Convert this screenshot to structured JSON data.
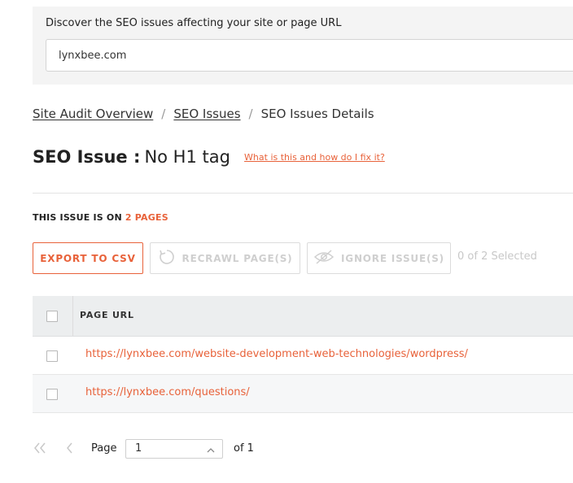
{
  "search": {
    "label": "Discover the SEO issues affecting your site or page URL",
    "value": "lynxbee.com"
  },
  "breadcrumb": {
    "items": [
      "Site Audit Overview",
      "SEO Issues"
    ],
    "current": "SEO Issues Details",
    "separator": "/"
  },
  "title": {
    "prefix": "SEO Issue :",
    "issue": "No H1 tag",
    "help_link": "What is this and how do I fix it?"
  },
  "issue_count": {
    "prefix": "THIS ISSUE IS ON",
    "count": "2 PAGES"
  },
  "toolbar": {
    "export_label": "EXPORT TO CSV",
    "recrawl_label": "RECRAWL PAGE(S)",
    "ignore_label": "IGNORE ISSUE(S)",
    "selected_text": "0 of 2 Selected"
  },
  "table": {
    "header": "PAGE URL",
    "rows": [
      "https://lynxbee.com/website-development-web-technologies/wordpress/",
      "https://lynxbee.com/questions/"
    ]
  },
  "pagination": {
    "page_label": "Page",
    "current_page": "1",
    "of_label": "of 1"
  },
  "colors": {
    "accent": "#e8623a",
    "disabled": "#cfcfcf",
    "header_bg": "#eceeef"
  }
}
